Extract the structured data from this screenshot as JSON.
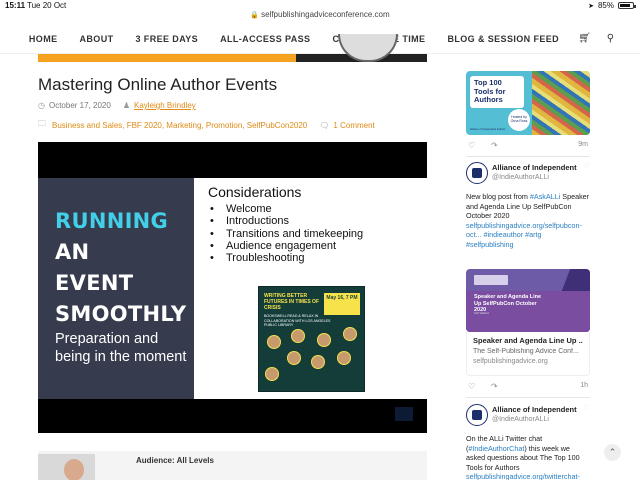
{
  "status_bar": {
    "time": "15:11",
    "date": "Tue 20 Oct",
    "url": "selfpublishingadviceconference.com",
    "battery": "85%",
    "battery_level": 0.85
  },
  "nav": {
    "items": [
      "HOME",
      "ABOUT",
      "3 FREE DAYS",
      "ALL-ACCESS PASS",
      "CONFERENCE TIME",
      "BLOG & SESSION FEED"
    ],
    "cart_icon": "cart-icon",
    "search_icon": "search-icon"
  },
  "post": {
    "title": "Mastering Online Author Events",
    "date": "October 17, 2020",
    "author": "Kayleigh Brindley",
    "categories": "Business and Sales, FBF 2020, Marketing, Promotion, SelfPubCon2020",
    "comments": "1 Comment"
  },
  "slide": {
    "heading_line1_a": "RUNNING",
    "heading_line1_b": " AN",
    "heading_line2": "EVENT",
    "heading_line3": "SMOOTHLY",
    "subtext": "Preparation and being in the moment",
    "considerations_title": "Considerations",
    "considerations": [
      "Welcome",
      "Introductions",
      "Transitions and timekeeping",
      "Audience engagement",
      "Troubleshooting"
    ],
    "poster_title": "WRITING BETTER FUTURES IN TIMES OF CRISIS",
    "poster_date": "May 16, 7 PM",
    "poster_sub": "BOOKSWELL READ & RELAX IN COLLABORATION WITH LOS ANGELES PUBLIC LIBRARY"
  },
  "author_box": {
    "audience": "Audience: All Levels"
  },
  "sidebar": {
    "card1": {
      "label": "Top 100 Tools for Authors",
      "circle": "Hosted by Orna Ross",
      "footer": "Alliance of Independent Authors",
      "timestamp": "9m"
    },
    "tweet1": {
      "name": "Alliance of Independent Au",
      "handle": "@IndieAuthorALLi",
      "text_a": "New blog post from ",
      "link_a": "#AskALLi",
      "text_b": " Speaker and Agenda Line Up SelfPubCon October 2020 ",
      "link_b": "selfpublishingadvice.org/selfpubcon-oct... #indieauthor #artg #selfpublishing"
    },
    "card2": {
      "image_title": "Speaker and Agenda Line Up SelfPubCon October 2020",
      "image_small": "KAYLEIGH",
      "link_title": "Speaker and Agenda Line Up ...",
      "link_desc": "The Self-Publishing Advice Conf...",
      "link_url": "selfpublishingadvice.org",
      "timestamp": "1h"
    },
    "tweet2": {
      "name": "Alliance of Independent Au",
      "handle": "@IndieAuthorALLi",
      "text_a": "On the ALLi Twitter chat (",
      "link_a": "#IndieAuthorChat",
      "text_b": ") this week we asked questions about The Top 100 Tools for Authors ",
      "link_b": "selfpublishingadvice.org/twitterchat-th..."
    }
  }
}
